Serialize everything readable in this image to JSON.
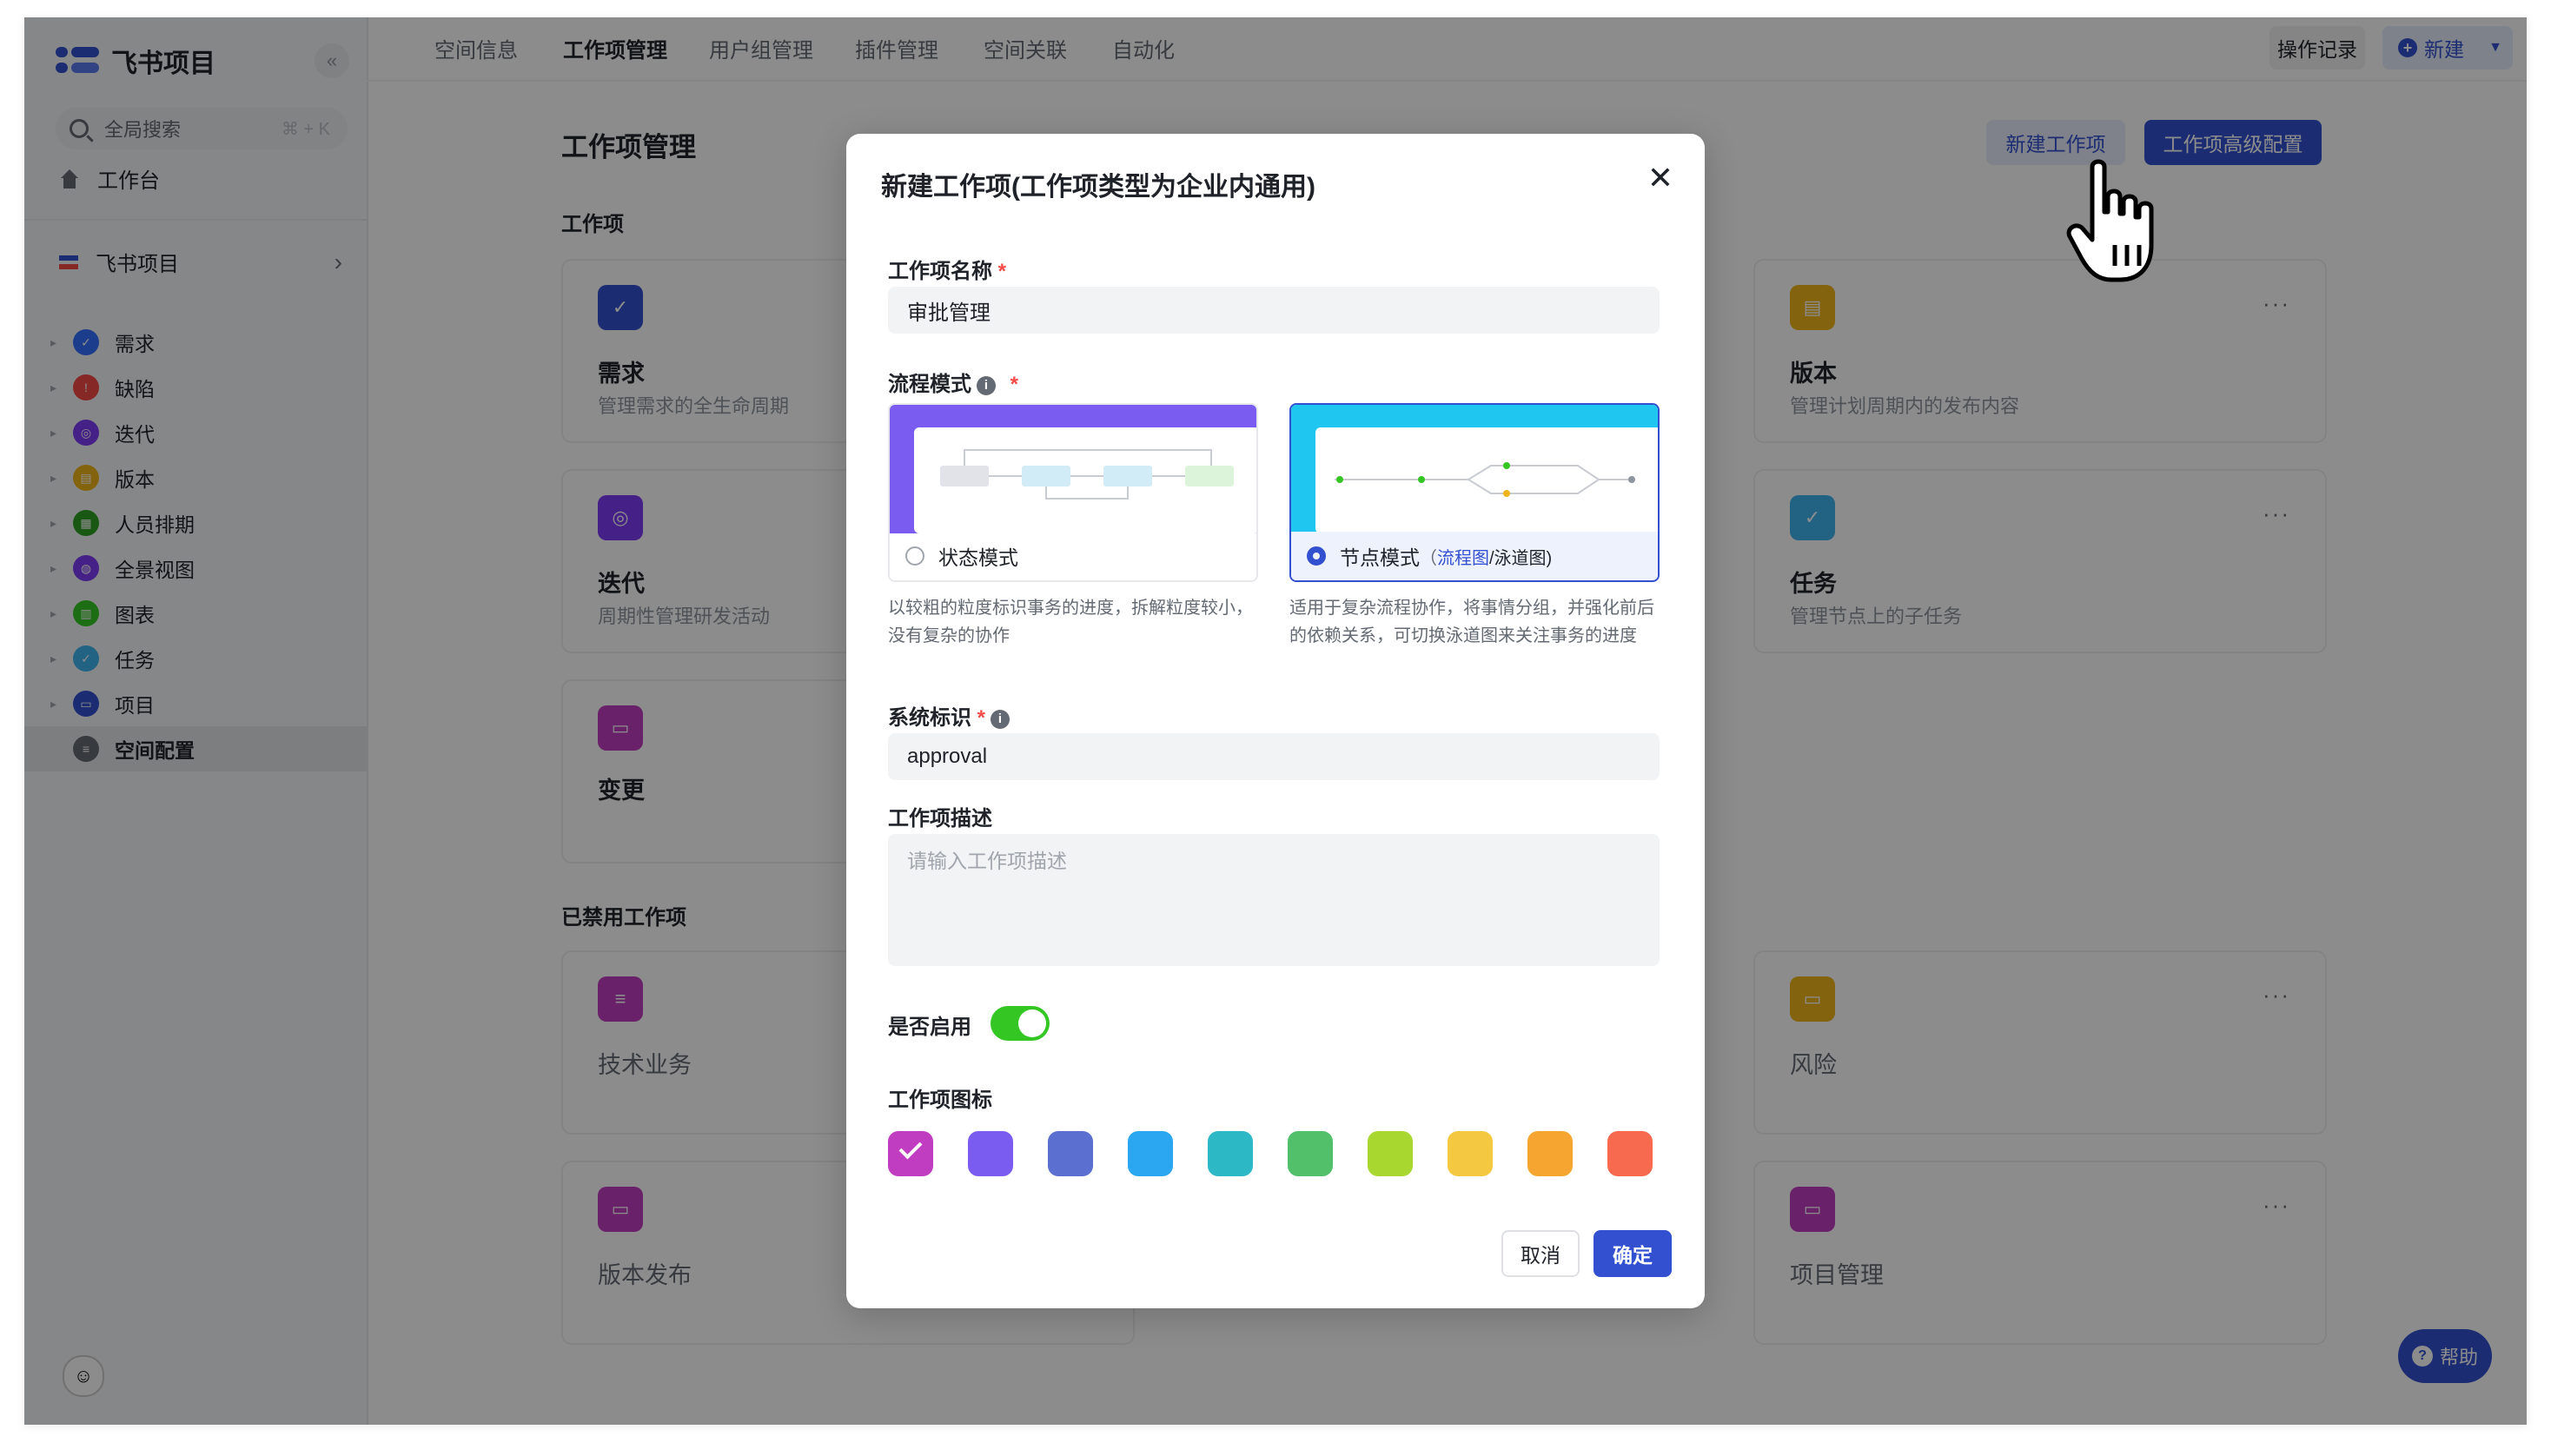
{
  "app": {
    "name": "飞书项目",
    "collapse_glyph": "«"
  },
  "sidebar": {
    "search_label": "全局搜索",
    "search_shortcut": "⌘ + K",
    "home_label": "工作台",
    "space_label": "飞书项目",
    "items": [
      {
        "label": "需求",
        "color": "#3370ff",
        "glyph": "✓"
      },
      {
        "label": "缺陷",
        "color": "#f54a45",
        "glyph": "!"
      },
      {
        "label": "迭代",
        "color": "#7f3bf5",
        "glyph": "◎"
      },
      {
        "label": "版本",
        "color": "#f0b51b",
        "glyph": "▤"
      },
      {
        "label": "人员排期",
        "color": "#2ea121",
        "glyph": "▦"
      },
      {
        "label": "全景视图",
        "color": "#7f3bf5",
        "glyph": "◍"
      },
      {
        "label": "图表",
        "color": "#34c724",
        "glyph": "▥"
      },
      {
        "label": "任务",
        "color": "#3eb5f0",
        "glyph": "✓"
      },
      {
        "label": "项目",
        "color": "#3250d0",
        "glyph": "▭"
      },
      {
        "label": "空间配置",
        "color": "#646a73",
        "glyph": "≡"
      }
    ]
  },
  "topnav": {
    "tabs": [
      "空间信息",
      "工作项管理",
      "用户组管理",
      "插件管理",
      "空间关联",
      "自动化"
    ],
    "active_tab": "工作项管理",
    "ops_label": "操作记录",
    "new_label": "新建"
  },
  "main": {
    "title": "工作项管理",
    "new_item_btn": "新建工作项",
    "advanced_btn": "工作项高级配置",
    "section_enabled": "工作项",
    "section_disabled": "已禁用工作项",
    "cards": [
      {
        "title": "需求",
        "desc": "管理需求的全生命周期",
        "color": "#3250d0"
      },
      {
        "title": "版本",
        "desc": "管理计划周期内的发布内容",
        "color": "#f0b51b"
      },
      {
        "title": "迭代",
        "desc": "周期性管理研发活动",
        "color": "#7f3bf5"
      },
      {
        "title": "任务",
        "desc": "管理节点上的子任务",
        "color": "#3eb5f0"
      },
      {
        "title": "变更",
        "desc": "",
        "color": "#c03cc0"
      }
    ],
    "disabled_cards": [
      {
        "title": "技术业务",
        "color": "#c03cc0"
      },
      {
        "title": "风险",
        "color": "#f0b51b"
      },
      {
        "title": "版本发布",
        "color": "#c03cc0"
      },
      {
        "title": "项目管理",
        "color": "#c03cc0"
      }
    ],
    "more_glyph": "···",
    "help_label": "帮助"
  },
  "modal": {
    "title": "新建工作项(工作项类型为企业内通用)",
    "close_glyph": "✕",
    "name_label": "工作项名称",
    "name_value": "审批管理",
    "flow_label": "流程模式",
    "required_mark": "*",
    "info_glyph": "i",
    "mode_state": {
      "label": "状态模式",
      "desc": "以较粗的粒度标识事务的进度，拆解粒度较小，没有复杂的协作"
    },
    "mode_node": {
      "label": "节点模式",
      "paren_open": "（",
      "link1": "流程图",
      "sep": "/泳道图)",
      "desc": "适用于复杂流程协作，将事情分组，并强化前后的依赖关系，可切换泳道图来关注事务的进度",
      "selected": true
    },
    "system_id_label": "系统标识",
    "system_id_value": "approval",
    "desc_label": "工作项描述",
    "desc_placeholder": "请输入工作项描述",
    "enable_label": "是否启用",
    "enabled": true,
    "icon_label": "工作项图标",
    "icon_colors": [
      "#c03cc0",
      "#7b5cf0",
      "#5b6fd0",
      "#2aa7f0",
      "#2cb8c4",
      "#52c06a",
      "#a8d830",
      "#f5c842",
      "#f7a531",
      "#f76a50"
    ],
    "selected_icon_index": 0,
    "cancel_label": "取消",
    "ok_label": "确定"
  }
}
